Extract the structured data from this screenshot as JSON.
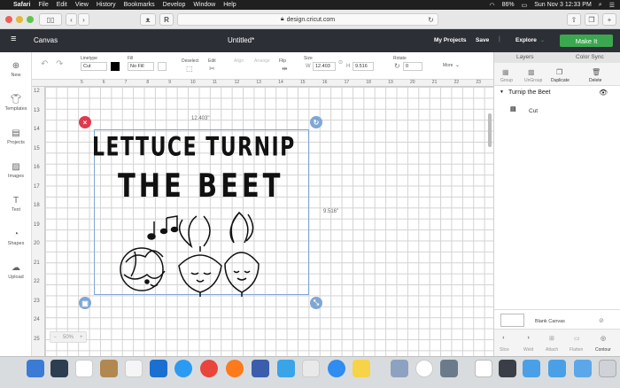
{
  "menubar": {
    "app": "Safari",
    "items": [
      "File",
      "Edit",
      "View",
      "History",
      "Bookmarks",
      "Develop",
      "Window",
      "Help"
    ],
    "battery": "86%",
    "datetime": "Sun Nov 3  12:33 PM"
  },
  "safari": {
    "url": "design.cricut.com"
  },
  "cricut": {
    "menu_label": "Canvas",
    "doc_title": "Untitled*",
    "my_projects": "My Projects",
    "save": "Save",
    "explore": "Explore",
    "make_it": "Make It"
  },
  "toolbar": {
    "undo": "↶",
    "redo": "↷",
    "linetype_label": "Linetype",
    "linetype_value": "Cut",
    "fill_label": "Fill",
    "fill_value": "No Fill",
    "deselect": "Deselect",
    "edit": "Edit",
    "align": "Align",
    "arrange": "Arrange",
    "flip": "Flip",
    "size_label": "Size",
    "w_label": "W",
    "w_value": "12.403",
    "h_label": "H",
    "h_value": "9.516",
    "rotate_label": "Rotate",
    "rotate_value": "0",
    "more": "More"
  },
  "sidebar": {
    "items": [
      {
        "label": "New",
        "icon": "plus-icon"
      },
      {
        "label": "Templates",
        "icon": "shirt-icon"
      },
      {
        "label": "Projects",
        "icon": "projects-icon"
      },
      {
        "label": "Images",
        "icon": "image-icon"
      },
      {
        "label": "Text",
        "icon": "text-icon"
      },
      {
        "label": "Shapes",
        "icon": "shapes-icon"
      },
      {
        "label": "Upload",
        "icon": "upload-icon"
      }
    ]
  },
  "layers": {
    "tab_layers": "Layers",
    "tab_color_sync": "Color Sync",
    "group": "Group",
    "ungroup": "UnGroup",
    "duplicate": "Duplicate",
    "delete": "Delete",
    "group_name": "Turnip the Beet",
    "layer_label": "Cut",
    "blank_canvas": "Blank Canvas",
    "bottom_actions": [
      "Slice",
      "Weld",
      "Attach",
      "Flatten",
      "Contour"
    ]
  },
  "ruler": {
    "top": [
      "5",
      "6",
      "7",
      "8",
      "9",
      "10",
      "11",
      "12",
      "13",
      "14",
      "15",
      "16",
      "17",
      "18",
      "19",
      "20",
      "21",
      "22",
      "23",
      "24",
      "25",
      "26"
    ],
    "left": [
      "12",
      "13",
      "14",
      "15",
      "16",
      "17",
      "18",
      "19",
      "20",
      "21",
      "22",
      "23",
      "24",
      "25"
    ]
  },
  "design": {
    "line1": "LETTUCE TURNIP",
    "line2": "THE BEET",
    "width_label": "12.403\"",
    "height_label": "9.516\""
  },
  "zoom": {
    "value": "50%",
    "minus": "−",
    "plus": "+"
  }
}
